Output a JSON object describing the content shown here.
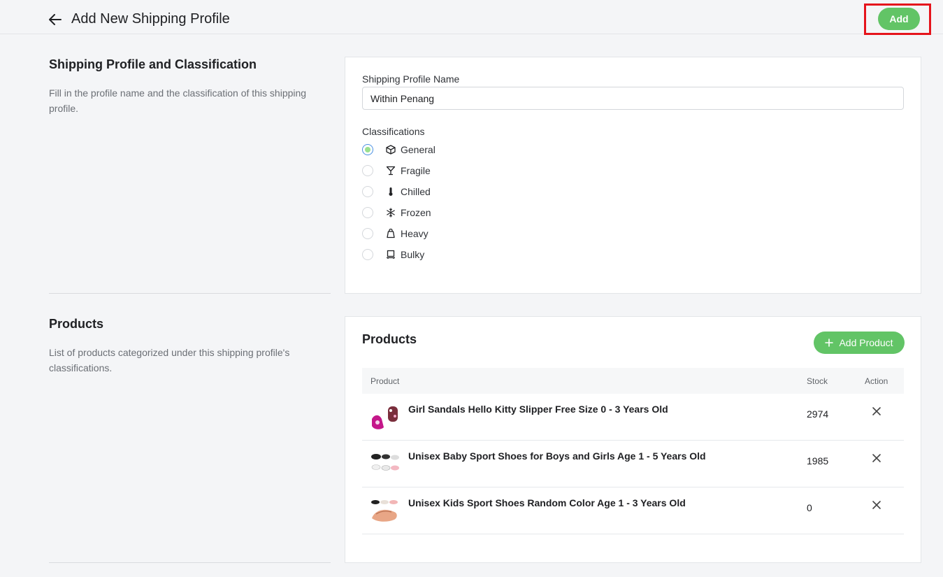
{
  "header": {
    "title": "Add New Shipping Profile",
    "add_label": "Add"
  },
  "colors": {
    "accent_green": "#62c466",
    "highlight_red": "#e5141c"
  },
  "profile_section": {
    "title": "Shipping Profile and Classification",
    "description": "Fill in the profile name and the classification of this shipping profile.",
    "name_label": "Shipping Profile Name",
    "name_value": "Within Penang",
    "classifications_label": "Classifications",
    "classifications": [
      {
        "label": "General",
        "icon": "box-icon",
        "selected": true
      },
      {
        "label": "Fragile",
        "icon": "glass-icon",
        "selected": false
      },
      {
        "label": "Chilled",
        "icon": "thermometer-icon",
        "selected": false
      },
      {
        "label": "Frozen",
        "icon": "snowflake-icon",
        "selected": false
      },
      {
        "label": "Heavy",
        "icon": "weight-icon",
        "selected": false
      },
      {
        "label": "Bulky",
        "icon": "bulky-icon",
        "selected": false
      }
    ]
  },
  "products_section": {
    "title": "Products",
    "description": "List of products categorized under this shipping profile's classifications.",
    "card_title": "Products",
    "add_product_label": "Add Product",
    "columns": {
      "product": "Product",
      "stock": "Stock",
      "action": "Action"
    },
    "rows": [
      {
        "name": "Girl Sandals Hello Kitty Slipper Free Size 0 - 3 Years Old",
        "stock": "2974"
      },
      {
        "name": "Unisex Baby Sport Shoes for Boys and Girls Age 1 - 5 Years Old",
        "stock": "1985"
      },
      {
        "name": "Unisex Kids Sport Shoes Random Color Age 1 - 3 Years Old",
        "stock": "0"
      }
    ]
  }
}
